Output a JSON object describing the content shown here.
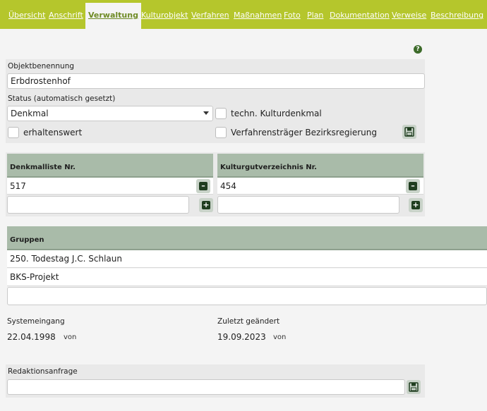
{
  "tabs": [
    "Übersicht",
    "Anschrift",
    "Verwaltung",
    "Kulturobjekt",
    "Verfahren",
    "Maßnahmen",
    "Foto",
    "Plan",
    "Dokumentation",
    "Verweise",
    "Beschreibung"
  ],
  "active_tab": "Verwaltung",
  "help_glyph": "?",
  "object": {
    "label": "Objektbenennung",
    "value": "Erbdrostenhof"
  },
  "status": {
    "label": "Status (automatisch gesetzt)",
    "value": "Denkmal"
  },
  "checkboxes": {
    "techn": "techn. Kulturdenkmal",
    "erhaltenswert": "erhaltenswert",
    "verfahrenstraeger": "Verfahrensträger Bezirksregierung"
  },
  "denkmalliste": {
    "header": "Denkmalliste Nr.",
    "value": "517",
    "new_value": ""
  },
  "kulturgut": {
    "header": "Kulturgutverzeichnis Nr.",
    "value": "454",
    "new_value": ""
  },
  "gruppen": {
    "header": "Gruppen",
    "items": [
      "250. Todestag J.C. Schlaun",
      "BKS-Projekt"
    ],
    "new_value": ""
  },
  "system": {
    "label": "Systemeingang",
    "date": "22.04.1998",
    "von": "von"
  },
  "changed": {
    "label": "Zuletzt geändert",
    "date": "19.09.2023",
    "von": "von"
  },
  "redaktion": {
    "label": "Redaktionsanfrage",
    "value": ""
  },
  "icons": {
    "save": "save-icon",
    "minus": "minus-icon",
    "plus": "plus-icon",
    "help": "help-icon",
    "dropdown": "chevron-down-icon"
  }
}
